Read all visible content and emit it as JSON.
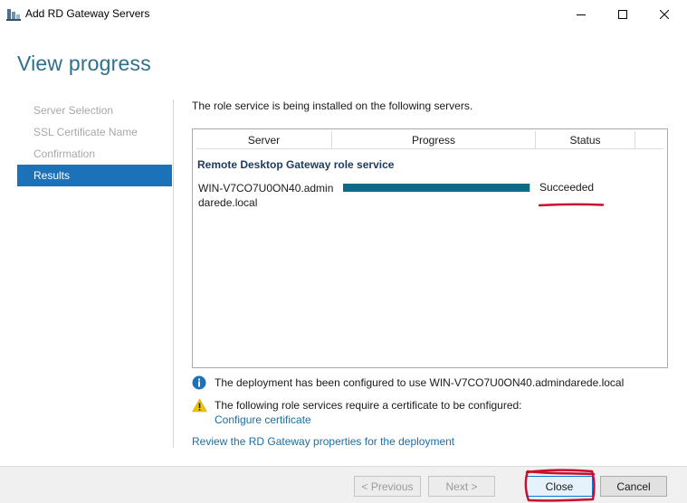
{
  "window": {
    "title": "Add RD Gateway Servers",
    "icon": "server-manager-icon",
    "controls": [
      "minimize-icon",
      "maximize-icon",
      "close-icon"
    ]
  },
  "page": {
    "title": "View progress"
  },
  "nav": {
    "items": [
      {
        "label": "Server Selection",
        "state": "disabled"
      },
      {
        "label": "SSL Certificate Name",
        "state": "disabled"
      },
      {
        "label": "Confirmation",
        "state": "disabled"
      },
      {
        "label": "Results",
        "state": "active"
      }
    ]
  },
  "main": {
    "intro": "The role service is being installed on the following servers.",
    "grid": {
      "columns": [
        "Server",
        "Progress",
        "Status"
      ],
      "group": "Remote Desktop Gateway role service",
      "rows": [
        {
          "server": "WIN-V7CO7U0ON40.admindarede.local",
          "progress": 1.0,
          "status": "Succeeded"
        }
      ]
    },
    "messages": {
      "info": "The deployment has been configured to use WIN-V7CO7U0ON40.admindarede.local",
      "warning": "The following role services require a certificate to be configured:",
      "configure_link": "Configure certificate"
    },
    "review_link": "Review the RD Gateway properties for the deployment"
  },
  "footer": {
    "previous": "< Previous",
    "next": "Next >",
    "close": "Close",
    "cancel": "Cancel"
  },
  "colors": {
    "accent": "#1c72b8",
    "title": "#2e6f8c",
    "progress": "#0f6a86",
    "link": "#1c6ea4",
    "annotation": "#c8102e",
    "info": "#1c72b8",
    "warning": "#f2c200"
  }
}
